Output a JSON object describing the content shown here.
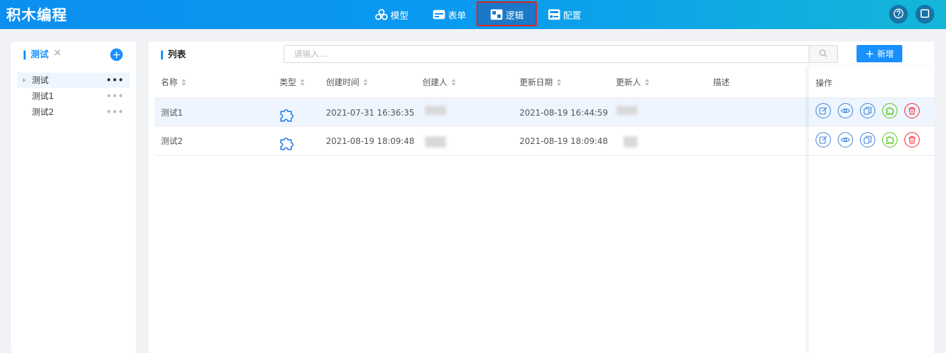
{
  "app": {
    "title": "积木编程"
  },
  "nav": {
    "items": [
      {
        "label": "模型",
        "icon": "model-icon"
      },
      {
        "label": "表单",
        "icon": "form-icon"
      },
      {
        "label": "逻辑",
        "icon": "logic-icon",
        "active": true
      },
      {
        "label": "配置",
        "icon": "config-icon"
      }
    ],
    "right_icons": [
      "help-icon",
      "fullscreen-icon"
    ]
  },
  "left_panel": {
    "tab_label": "测试",
    "tree": [
      {
        "label": "测试",
        "selected": true
      },
      {
        "label": "测试1"
      },
      {
        "label": "测试2"
      }
    ]
  },
  "list_panel": {
    "title": "列表",
    "search_placeholder": "请输入...",
    "add_label": "新增",
    "columns": [
      "名称",
      "类型",
      "创建时间",
      "创建人",
      "更新日期",
      "更新人",
      "描述",
      "操作"
    ],
    "rows": [
      {
        "name": "测试1",
        "type_icon": "puzzle-icon",
        "created": "2021-07-31 16:36:35",
        "creator": "",
        "updated": "2021-08-19 16:44:59",
        "updater": "",
        "desc": ""
      },
      {
        "name": "测试2",
        "type_icon": "puzzle-icon",
        "created": "2021-08-19 18:09:48",
        "creator": "",
        "updated": "2021-08-19 18:09:48",
        "updater": "",
        "desc": ""
      }
    ],
    "actions": [
      "edit-icon",
      "view-icon",
      "copy-icon",
      "puzzle-icon",
      "delete-icon"
    ]
  },
  "colors": {
    "primary": "#1890ff",
    "header_start": "#0b8ff0",
    "header_end": "#14b6d8",
    "delete": "#f5222d",
    "success": "#52c41a",
    "highlight": "#e0241c"
  }
}
